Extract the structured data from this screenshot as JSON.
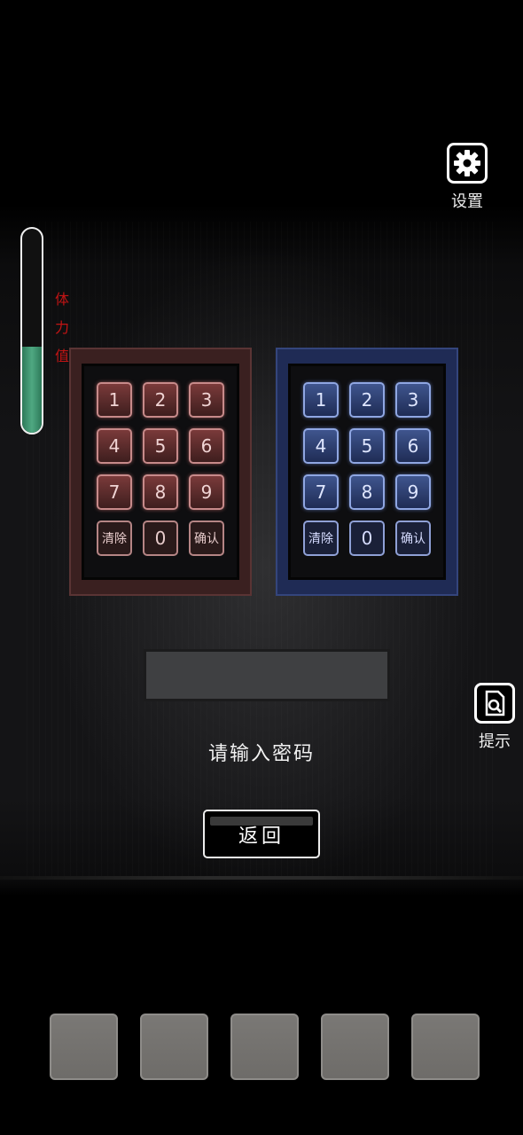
{
  "settings": {
    "label": "设置",
    "icon": "gear-icon"
  },
  "hint": {
    "label": "提示",
    "icon": "document-search-icon"
  },
  "stamina": {
    "label": "体力值",
    "level_fraction": 0.42,
    "fill_color": "#3f9874"
  },
  "keypad_red": {
    "keys": [
      "1",
      "2",
      "3",
      "4",
      "5",
      "6",
      "7",
      "8",
      "9",
      "清除",
      "0",
      "确认"
    ],
    "accent": "#c78a8a"
  },
  "keypad_blue": {
    "keys": [
      "1",
      "2",
      "3",
      "4",
      "5",
      "6",
      "7",
      "8",
      "9",
      "清除",
      "0",
      "确认"
    ],
    "accent": "#8fa6e2"
  },
  "password_display": {
    "value": ""
  },
  "prompt": "请输入密码",
  "back_button": {
    "label": "返回"
  },
  "inventory": {
    "slots": [
      "",
      "",
      "",
      "",
      ""
    ]
  }
}
